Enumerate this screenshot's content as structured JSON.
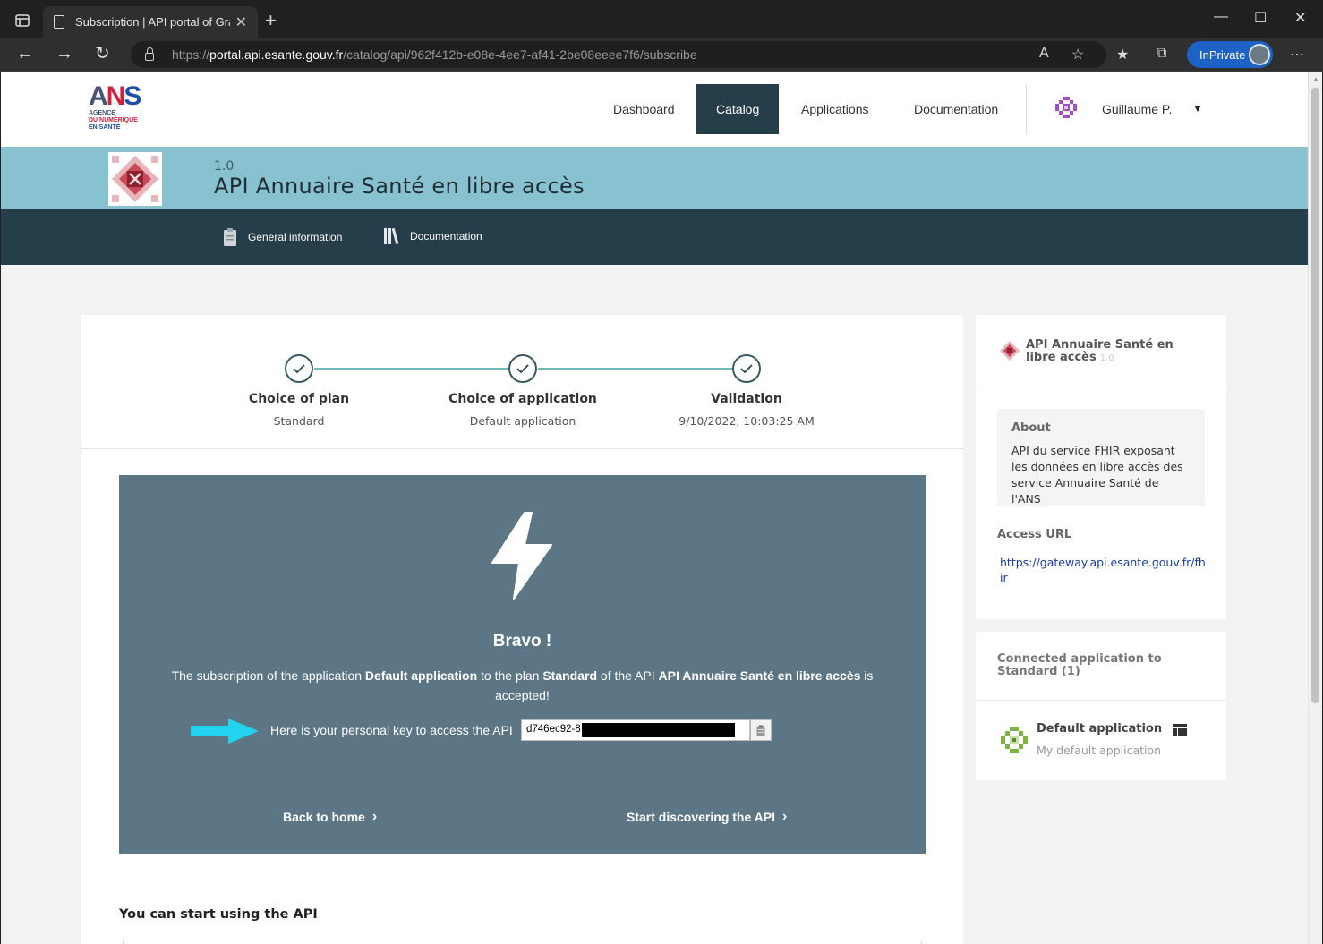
{
  "browser": {
    "tab_title": "Subscription | API portal of Gravi",
    "url_scheme": "https://",
    "url_host": "portal.api.esante.gouv.fr",
    "url_path": "/catalog/api/962f412b-e08e-4ee7-af41-2be08eeee7f6/subscribe",
    "inprivate_label": "InPrivate"
  },
  "logo": {
    "mark": "ANS",
    "line1": "AGENCE",
    "line2": "DU NUMÉRIQUE",
    "line3": "EN SANTÉ"
  },
  "nav": {
    "items": [
      {
        "label": "Dashboard"
      },
      {
        "label": "Catalog"
      },
      {
        "label": "Applications"
      },
      {
        "label": "Documentation"
      }
    ],
    "active": "Catalog",
    "user_name": "Guillaume P."
  },
  "api": {
    "version": "1.0",
    "title": "API Annuaire Santé en libre accès",
    "subnav": [
      {
        "label": "General information",
        "icon": "clipboard-icon"
      },
      {
        "label": "Documentation",
        "icon": "books-icon"
      }
    ]
  },
  "stepper": {
    "steps": [
      {
        "title": "Choice of plan",
        "subtitle": "Standard"
      },
      {
        "title": "Choice of application",
        "subtitle": "Default application"
      },
      {
        "title": "Validation",
        "subtitle": "9/10/2022, 10:03:25 AM"
      }
    ]
  },
  "success": {
    "heading": "Bravo !",
    "msg_part1": "The subscription of the application ",
    "msg_app": "Default application",
    "msg_part2": " to the plan ",
    "msg_plan": "Standard",
    "msg_part3": " of the API ",
    "msg_api": "API Annuaire Santé en libre accès",
    "msg_part4": " is accepted!",
    "key_label": "Here is your personal key to access the API",
    "key_value": "d746ec92-8",
    "back_label": "Back to home",
    "discover_label": "Start discovering the API"
  },
  "start_using": "You can start using the API",
  "sidebar": {
    "api_name": "API Annuaire Santé en libre accès",
    "api_version": "1.0",
    "about_heading": "About",
    "about_text": "API du service FHIR exposant les données en libre accès des service Annuaire Santé de l'ANS",
    "access_heading": "Access URL",
    "access_url": "https://gateway.api.esante.gouv.fr/fhir",
    "connected_heading": "Connected application to Standard (1)",
    "app_name": "Default application",
    "app_desc": "My default application"
  },
  "colors": {
    "accent_dark": "#263e49",
    "banner": "#88c1cf",
    "success_panel": "#5d7685",
    "stepper_line": "#6fb9b9",
    "arrow": "#22d3f0"
  }
}
